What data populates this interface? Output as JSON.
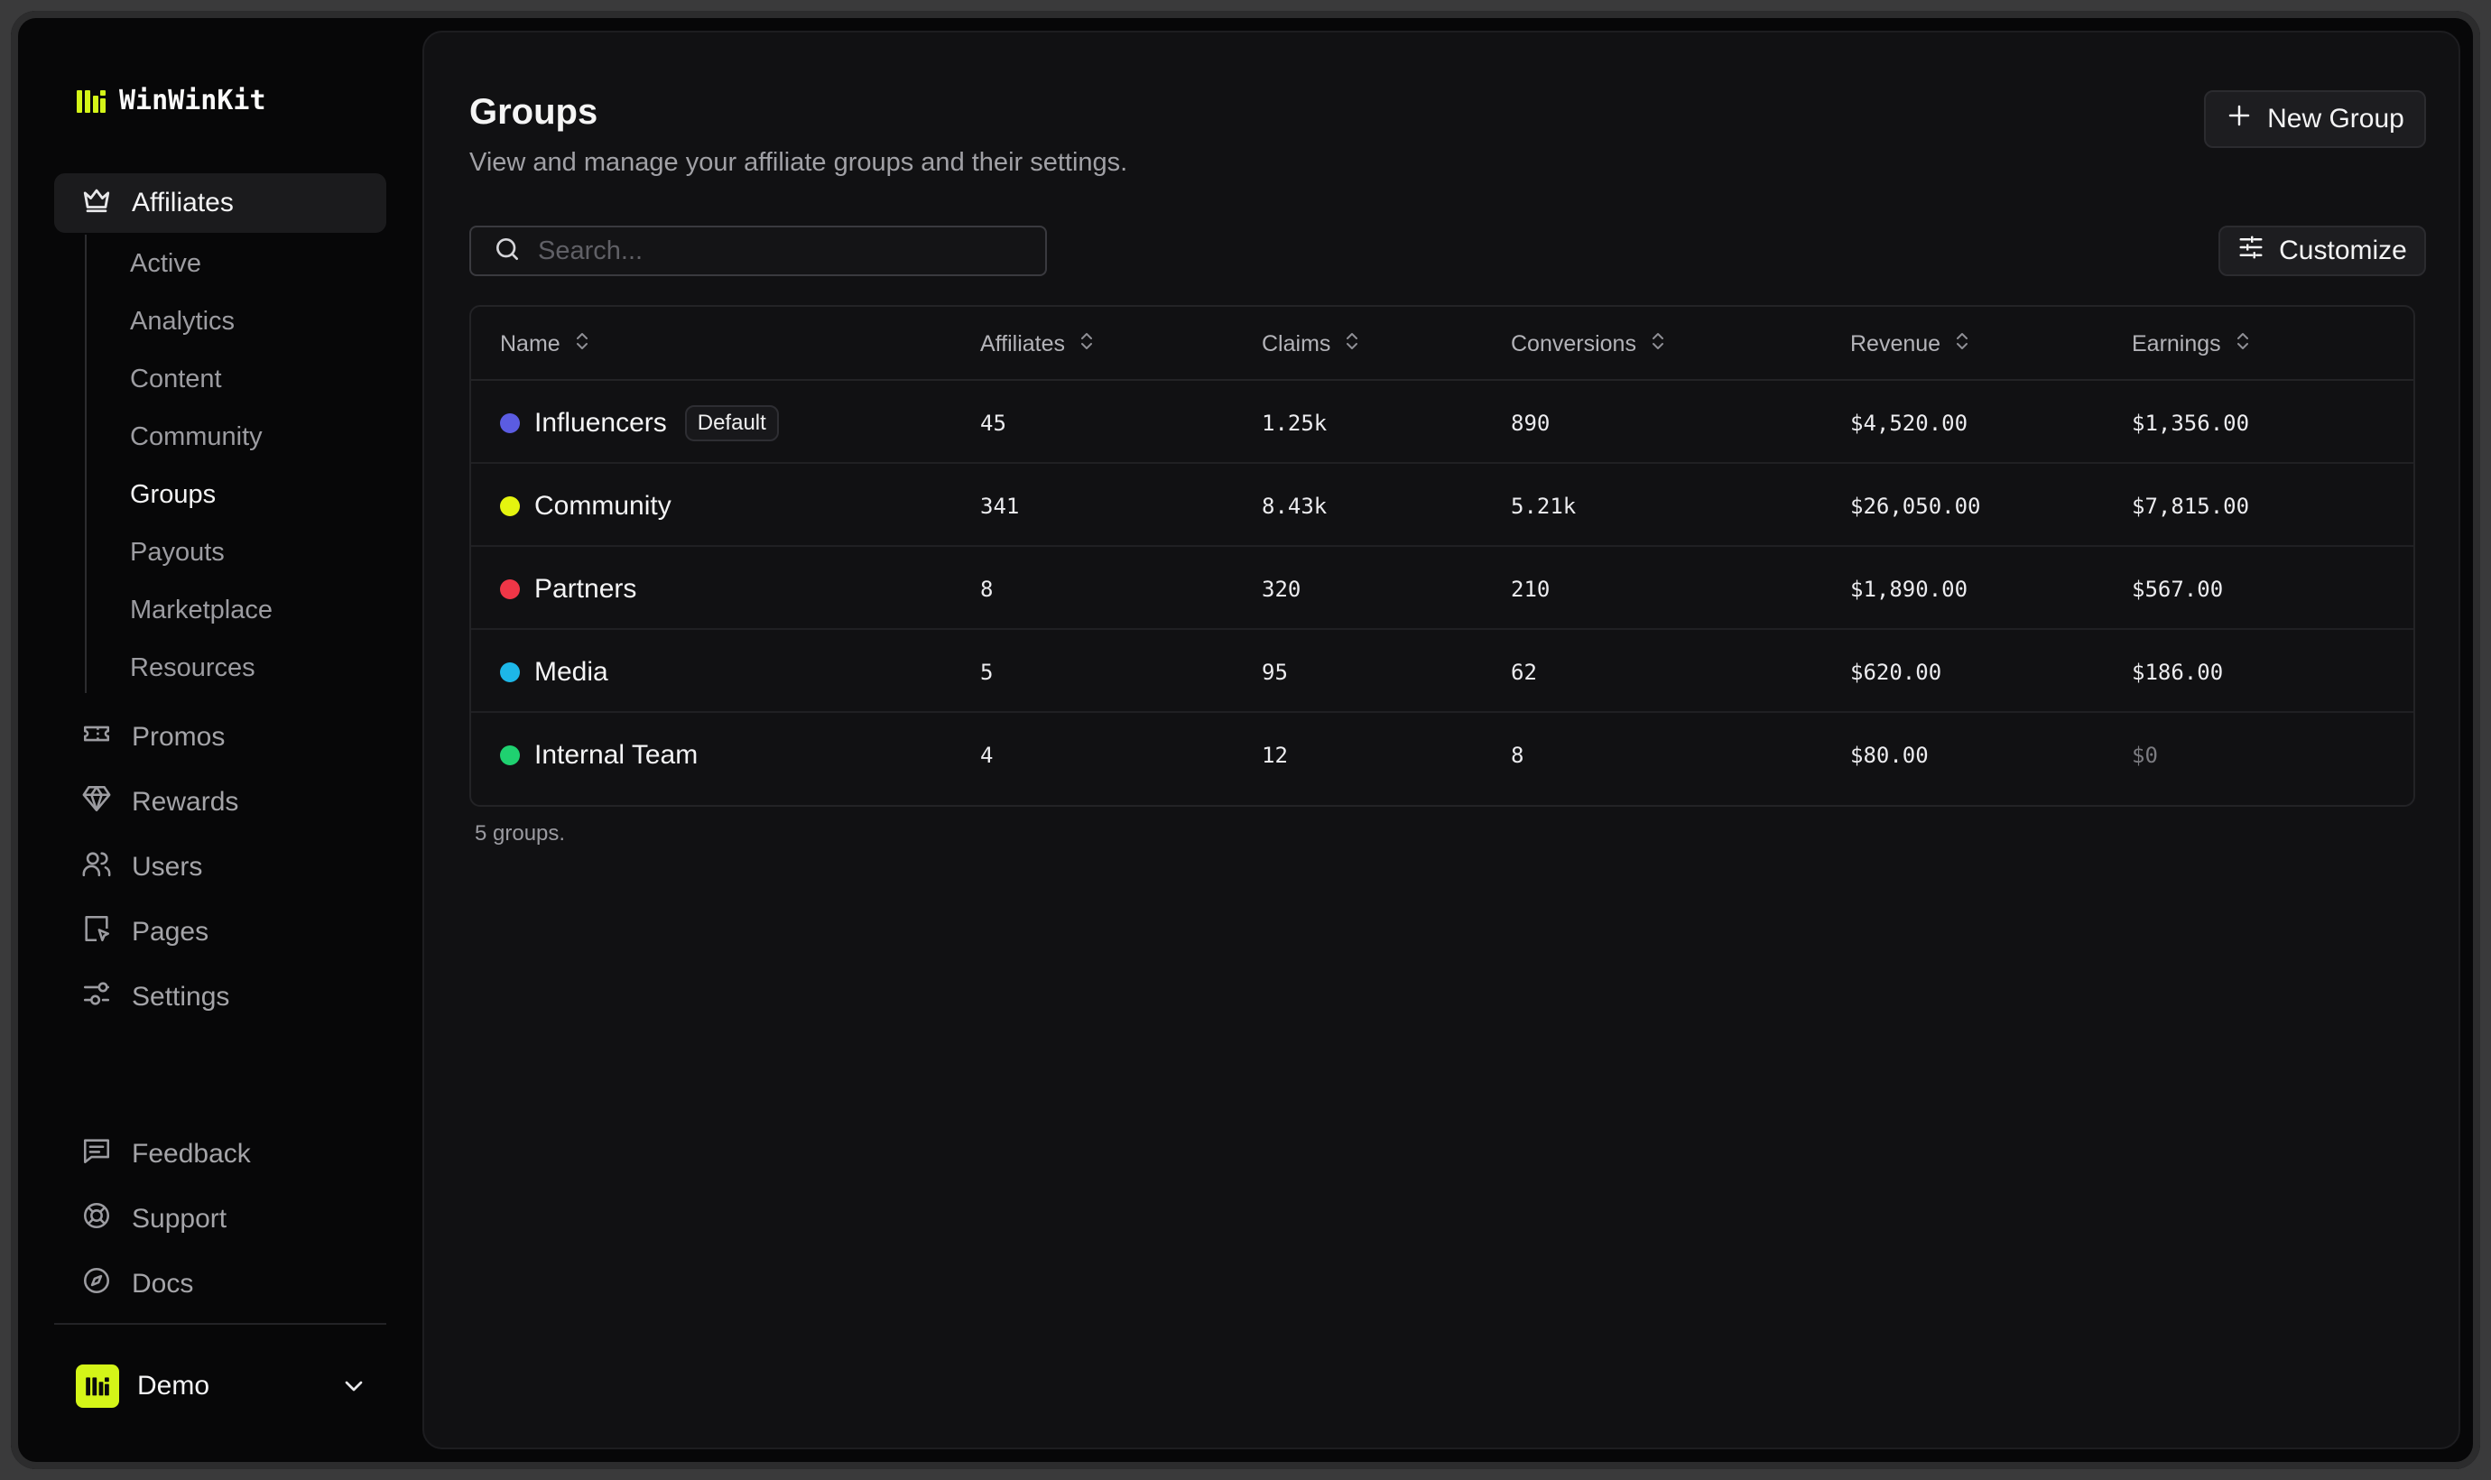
{
  "brand": {
    "name": "WinWinKit",
    "accent": "#d4f518"
  },
  "sidebar": {
    "primary": {
      "label": "Affiliates",
      "icon": "crown-icon"
    },
    "subitems": [
      {
        "label": "Active"
      },
      {
        "label": "Analytics"
      },
      {
        "label": "Content"
      },
      {
        "label": "Community"
      },
      {
        "label": "Groups",
        "current": true
      },
      {
        "label": "Payouts"
      },
      {
        "label": "Marketplace"
      },
      {
        "label": "Resources"
      }
    ],
    "items": [
      {
        "label": "Promos",
        "icon": "ticket-icon"
      },
      {
        "label": "Rewards",
        "icon": "gem-icon"
      },
      {
        "label": "Users",
        "icon": "users-icon"
      },
      {
        "label": "Pages",
        "icon": "page-icon"
      },
      {
        "label": "Settings",
        "icon": "sliders-icon"
      }
    ],
    "bottom_items": [
      {
        "label": "Feedback",
        "icon": "message-square-icon"
      },
      {
        "label": "Support",
        "icon": "lifebuoy-icon"
      },
      {
        "label": "Docs",
        "icon": "compass-icon"
      }
    ],
    "workspace": {
      "name": "Demo"
    }
  },
  "header": {
    "title": "Groups",
    "subtitle": "View and manage your affiliate groups and their settings.",
    "new_button": "New Group",
    "customize_button": "Customize"
  },
  "search": {
    "placeholder": "Search..."
  },
  "table": {
    "columns": [
      "Name",
      "Affiliates",
      "Claims",
      "Conversions",
      "Revenue",
      "Earnings"
    ],
    "rows": [
      {
        "name": "Influencers",
        "badge": "Default",
        "color": "#5b5ce2",
        "affiliates": "45",
        "claims": "1.25k",
        "conversions": "890",
        "revenue": "$4,520.00",
        "earnings": "$1,356.00"
      },
      {
        "name": "Community",
        "color": "#e4f40f",
        "affiliates": "341",
        "claims": "8.43k",
        "conversions": "5.21k",
        "revenue": "$26,050.00",
        "earnings": "$7,815.00"
      },
      {
        "name": "Partners",
        "color": "#ef3647",
        "affiliates": "8",
        "claims": "320",
        "conversions": "210",
        "revenue": "$1,890.00",
        "earnings": "$567.00"
      },
      {
        "name": "Media",
        "color": "#1db7e8",
        "affiliates": "5",
        "claims": "95",
        "conversions": "62",
        "revenue": "$620.00",
        "earnings": "$186.00"
      },
      {
        "name": "Internal Team",
        "color": "#1fd170",
        "affiliates": "4",
        "claims": "12",
        "conversions": "8",
        "revenue": "$80.00",
        "earnings": "$0"
      }
    ],
    "footer": "5 groups."
  }
}
